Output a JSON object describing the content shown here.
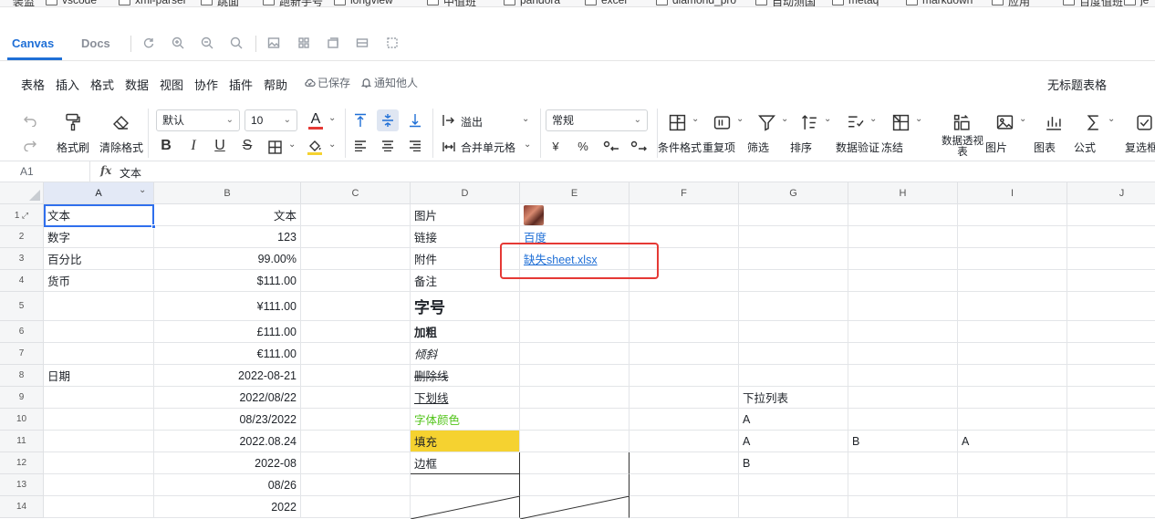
{
  "bookmarks": [
    "装监",
    "vscode",
    "xml-parser",
    "跳面",
    "跑新手号",
    "longview",
    "中值班",
    "pandora",
    "excel",
    "diamond_pro",
    "自动测国",
    "metaq",
    "markdown",
    "应用",
    "百度值班",
    "je"
  ],
  "topbar": {
    "tabs": [
      {
        "label": "Canvas",
        "active": true
      },
      {
        "label": "Docs",
        "active": false
      }
    ],
    "tool_icons": [
      "refresh-icon",
      "zoom-in-icon",
      "zoom-out-icon",
      "reset-zoom-icon",
      "image-icon",
      "grid-icon",
      "layers-icon",
      "row-icon",
      "select-area-icon"
    ]
  },
  "menubar": {
    "items": [
      "表格",
      "插入",
      "格式",
      "数据",
      "视图",
      "协作",
      "插件",
      "帮助"
    ],
    "saved": "已保存",
    "notify": "通知他人",
    "doc_title": "无标题表格"
  },
  "ribbon": {
    "format_painter": "格式刷",
    "clear_format": "清除格式",
    "font_family": "默认",
    "font_size": "10",
    "font_color_glyph": "A",
    "overflow": "溢出",
    "merge_cells": "合并单元格",
    "number_format": "常规",
    "currency_glyph": "¥",
    "percent_glyph": "%",
    "bold_glyph": "B",
    "italic_glyph": "I",
    "underline_glyph": "U",
    "strike_glyph": "S",
    "tools": [
      {
        "label": "条件格式",
        "icon": "conditional-format-icon"
      },
      {
        "label": "重复项",
        "icon": "duplicate-icon"
      },
      {
        "label": "筛选",
        "icon": "filter-icon"
      },
      {
        "label": "排序",
        "icon": "sort-icon"
      },
      {
        "label": "数据验证",
        "icon": "data-validation-icon"
      },
      {
        "label": "冻结",
        "icon": "freeze-icon"
      },
      {
        "label": "数据透视表",
        "icon": "pivot-icon"
      },
      {
        "label": "图片",
        "icon": "picture-icon"
      },
      {
        "label": "图表",
        "icon": "chart-icon"
      },
      {
        "label": "公式",
        "icon": "formula-icon"
      },
      {
        "label": "复选框",
        "icon": "checkbox-icon"
      }
    ]
  },
  "formula_bar": {
    "cell_ref": "A1",
    "fx": "fx",
    "value": "文本"
  },
  "grid": {
    "columns": [
      "A",
      "B",
      "C",
      "D",
      "E",
      "F",
      "G",
      "H",
      "I",
      "J"
    ],
    "rows": [
      "1",
      "2",
      "3",
      "4",
      "5",
      "6",
      "7",
      "8",
      "9",
      "10",
      "11",
      "12",
      "13",
      "14"
    ],
    "cells": {
      "A1": "文本",
      "B1": "文本",
      "D1": "图片",
      "A2": "数字",
      "B2": "123",
      "D2": "链接",
      "E2": "百度",
      "A3": "百分比",
      "B3": "99.00%",
      "D3": "附件",
      "E3": "缺失sheet.xlsx",
      "A4": "货币",
      "B4": "$111.00",
      "D4": "备注",
      "B5": "¥111.00",
      "D5": "字号",
      "B6": "£111.00",
      "D6": "加粗",
      "B7": "€111.00",
      "D7": "倾斜",
      "A8": "日期",
      "B8": "2022-08-21",
      "D8": "删除线",
      "B9": "2022/08/22",
      "D9": "下划线",
      "G9": "下拉列表",
      "B10": "08/23/2022",
      "D10": "字体颜色",
      "G10": "A",
      "B11": "2022.08.24",
      "D11": "填充",
      "G11": "A",
      "H11": "B",
      "I11": "A",
      "B12": "2022-08",
      "D12": "边框",
      "G12": "B",
      "B13": "08/26",
      "B14": "2022"
    },
    "colors": {
      "fill": "#f5d230",
      "font_color": "#52c41a",
      "link": "#1f6fd6",
      "highlight": "#e53935"
    }
  }
}
